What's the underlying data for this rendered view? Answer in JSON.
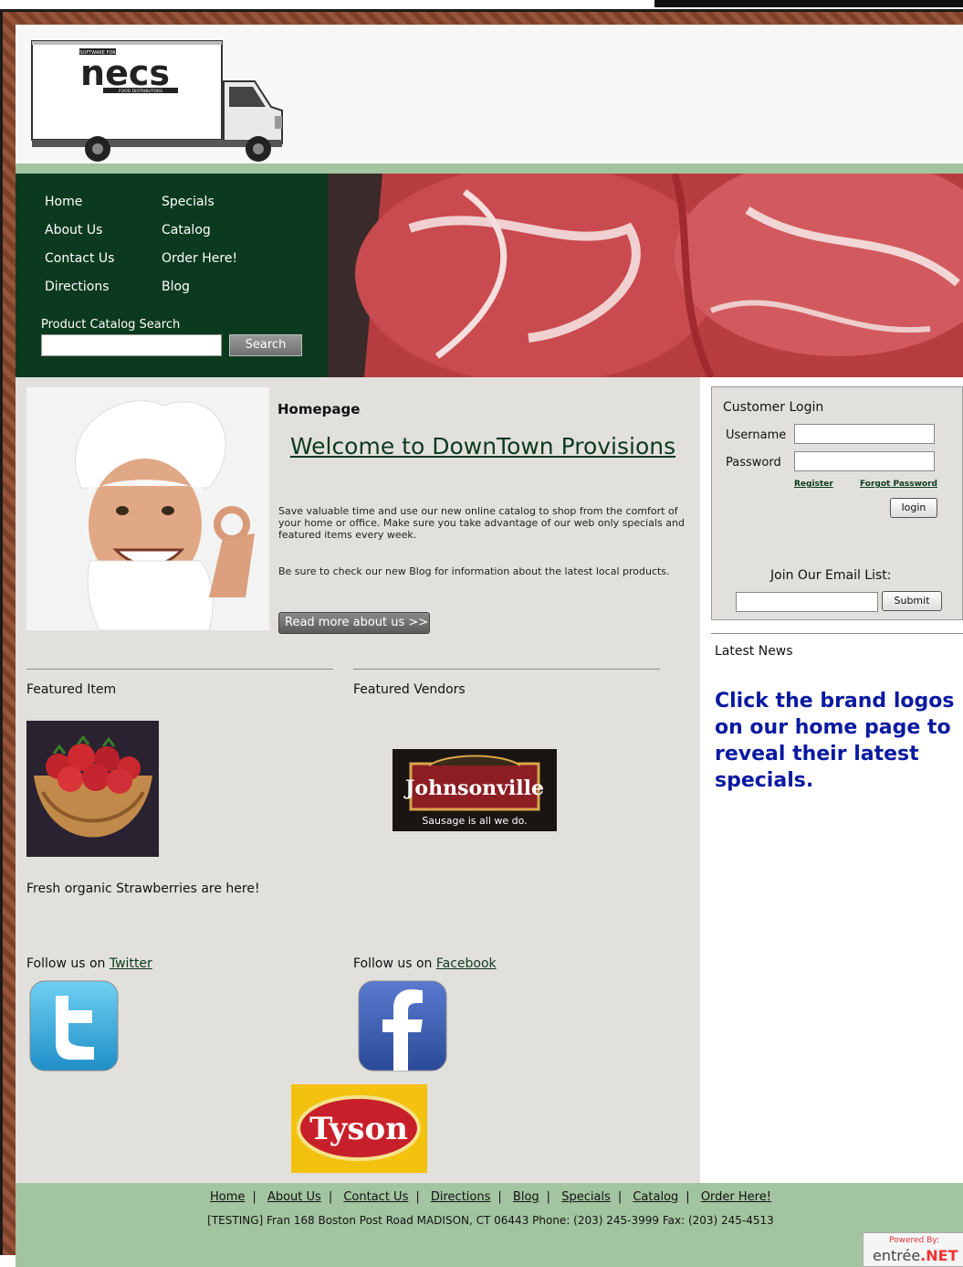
{
  "brand": {
    "logo_text": "necs",
    "logo_tag_top": "SOFTWARE FOR",
    "logo_tag_bottom": "FOOD DISTRIBUTORS"
  },
  "nav": {
    "home": "Home",
    "specials": "Specials",
    "about": "About Us",
    "catalog": "Catalog",
    "contact": "Contact Us",
    "order": "Order Here!",
    "directions": "Directions",
    "blog": "Blog"
  },
  "search": {
    "label": "Product Catalog Search",
    "value": "",
    "button": "Search"
  },
  "main": {
    "heading": "Homepage",
    "welcome": "Welcome to DownTown Provisions",
    "para1": "Save valuable time and use our new online catalog to shop from the comfort of your home or office. Make sure you take advantage of our web only specials and featured items every week.",
    "para2": "Be sure to check our new Blog for information about the latest local products.",
    "read_more": "Read more about us >>"
  },
  "featured": {
    "item_title": "Featured Item",
    "vendors_title": "Featured Vendors",
    "item_caption": "Fresh organic Strawberries are here!"
  },
  "vendor_logos": {
    "johnsonville": "Johnsonville",
    "johnsonville_tag": "Sausage is all we do.",
    "tyson": "Tyson"
  },
  "social": {
    "twitter_prefix": "Follow us on ",
    "twitter_link": "Twitter",
    "facebook_prefix": "Follow us on ",
    "facebook_link": "Facebook"
  },
  "login": {
    "title": "Customer Login",
    "username_label": "Username",
    "password_label": "Password",
    "username_value": "",
    "password_value": "",
    "register": "Register",
    "forgot": "Forgot Password",
    "login_button": "login",
    "email_title": "Join Our Email List:",
    "email_value": "",
    "submit": "Submit"
  },
  "news": {
    "title": "Latest News",
    "promo": "Click the brand logos on our home page to reveal their latest specials."
  },
  "footer": {
    "links": [
      "Home",
      "About Us",
      "Contact Us",
      "Directions",
      "Blog",
      "Specials",
      "Catalog",
      "Order Here!"
    ],
    "address": "[TESTING] Fran 168 Boston Post Road MADISON, CT 06443 Phone: (203) 245-3999 Fax: (203) 245-4513",
    "powered_by": "Powered By:",
    "entree": "entrée",
    "net": ".NET"
  },
  "colors": {
    "nav_bg": "#0c3a1f",
    "strip": "#a3c4a0",
    "promo": "#0a1aa0"
  }
}
